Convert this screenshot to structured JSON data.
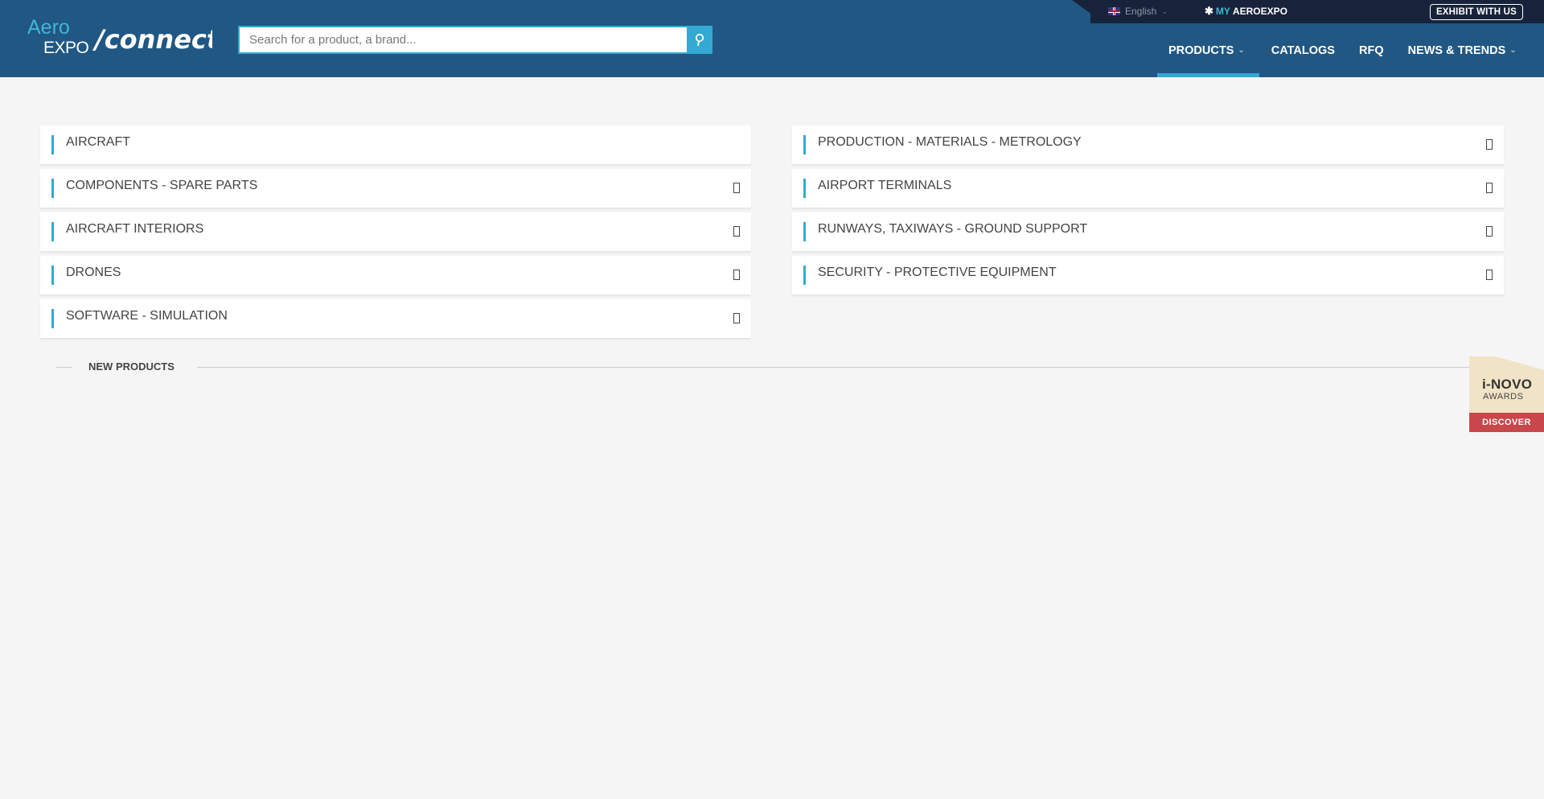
{
  "header": {
    "logo": {
      "word1": "Aero",
      "word2": "EXPO",
      "word3": "/connect"
    },
    "search": {
      "placeholder": "Search for a product, a brand..."
    },
    "topbar": {
      "language": "English",
      "my_prefix": "MY",
      "my_suffix": "AEROEXPO",
      "exhibit_label": "EXHIBIT WITH US"
    },
    "nav": [
      {
        "label": "PRODUCTS",
        "active": true,
        "has_dropdown": true
      },
      {
        "label": "CATALOGS",
        "active": false,
        "has_dropdown": false
      },
      {
        "label": "RFQ",
        "active": false,
        "has_dropdown": false
      },
      {
        "label": "NEWS & TRENDS",
        "active": false,
        "has_dropdown": true
      }
    ]
  },
  "categories": {
    "left": [
      {
        "label": "AIRCRAFT",
        "expandable": false
      },
      {
        "label": "COMPONENTS - SPARE PARTS",
        "expandable": true
      },
      {
        "label": "AIRCRAFT INTERIORS",
        "expandable": true
      },
      {
        "label": "DRONES",
        "expandable": true
      },
      {
        "label": "SOFTWARE - SIMULATION",
        "expandable": true
      }
    ],
    "right": [
      {
        "label": "PRODUCTION - MATERIALS - METROLOGY",
        "expandable": true
      },
      {
        "label": "AIRPORT TERMINALS",
        "expandable": true
      },
      {
        "label": "RUNWAYS, TAXIWAYS - GROUND SUPPORT",
        "expandable": true
      },
      {
        "label": "SECURITY - PROTECTIVE EQUIPMENT",
        "expandable": true
      }
    ]
  },
  "new_products": {
    "label": "NEW PRODUCTS"
  },
  "awards_badge": {
    "line1": "i-NOVO",
    "line2": "AWARDS",
    "cta": "DISCOVER"
  },
  "colors": {
    "header_bg": "#215783",
    "topbar_bg": "#17233a",
    "accent": "#33a9d3",
    "awards_red": "#c7474b",
    "awards_cream": "#f1e3c6"
  }
}
